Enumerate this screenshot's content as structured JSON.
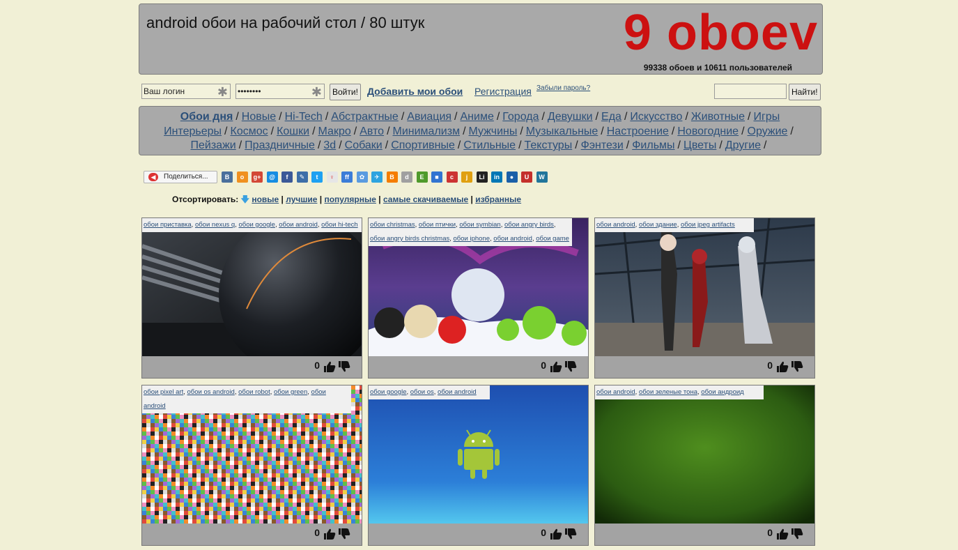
{
  "header": {
    "title": "android обои на рабочий стол / 80 штук",
    "logo": "9 oboev",
    "stats": "99338 обоев и 10611 пользователей"
  },
  "login": {
    "username_value": "Ваш логин",
    "password_value": "••••••••",
    "submit": "Войти!",
    "add_link": "Добавить мои обои",
    "register": "Регистрация",
    "forgot": "Забыли пароль?",
    "search_value": "",
    "search_button": "Найти!"
  },
  "categories": [
    "Обои дня",
    "Новые",
    "Hi-Tech",
    "Абстрактные",
    "Авиация",
    "Аниме",
    "Города",
    "Девушки",
    "Еда",
    "Искусство",
    "Животные",
    "Игры",
    "Интерьеры",
    "Космос",
    "Кошки",
    "Макро",
    "Авто",
    "Минимализм",
    "Мужчины",
    "Музыкальные",
    "Настроение",
    "Новогодние",
    "Оружие",
    "Пейзажи",
    "Праздничные",
    "3d",
    "Собаки",
    "Спортивные",
    "Стильные",
    "Текстуры",
    "Фэнтези",
    "Фильмы",
    "Цветы",
    "Другие"
  ],
  "share": {
    "label": "Поделиться...",
    "icons": [
      {
        "name": "vkontakte-icon",
        "glyph": "В",
        "color": "#4a6f9c"
      },
      {
        "name": "odnoklassniki-icon",
        "glyph": "о",
        "color": "#f09020"
      },
      {
        "name": "google-plus-icon",
        "glyph": "g+",
        "color": "#d34836"
      },
      {
        "name": "mail-ru-icon",
        "glyph": "@",
        "color": "#168de2"
      },
      {
        "name": "facebook-icon",
        "glyph": "f",
        "color": "#3b5998"
      },
      {
        "name": "livejournal-icon",
        "glyph": "✎",
        "color": "#3d6ea8"
      },
      {
        "name": "twitter-icon",
        "glyph": "t",
        "color": "#1da1f2"
      },
      {
        "name": "liveinternet-icon",
        "glyph": "♀",
        "color": "#e6e6e6"
      },
      {
        "name": "friendfeed-icon",
        "glyph": "ff",
        "color": "#3b7dd8"
      },
      {
        "name": "myspace-icon",
        "glyph": "✿",
        "color": "#5a9be0"
      },
      {
        "name": "bookmarks-icon",
        "glyph": "✈",
        "color": "#2ea4e0"
      },
      {
        "name": "blogger-icon",
        "glyph": "B",
        "color": "#f57d00"
      },
      {
        "name": "digg-icon",
        "glyph": "d",
        "color": "#a0a0a0"
      },
      {
        "name": "evernote-icon",
        "glyph": "E",
        "color": "#4f9a2b"
      },
      {
        "name": "delicious-icon",
        "glyph": "■",
        "color": "#3274d1"
      },
      {
        "name": "stumbleupon-icon",
        "glyph": "c",
        "color": "#c33"
      },
      {
        "name": "juick-icon",
        "glyph": "j",
        "color": "#e0a010"
      },
      {
        "name": "liveinternet-li-icon",
        "glyph": "Li",
        "color": "#222"
      },
      {
        "name": "linkedin-icon",
        "glyph": "in",
        "color": "#0077b5"
      },
      {
        "name": "moimir-icon",
        "glyph": "●",
        "color": "#1a5fa8"
      },
      {
        "name": "surfingbird-icon",
        "glyph": "U",
        "color": "#c4302b"
      },
      {
        "name": "wordpress-icon",
        "glyph": "W",
        "color": "#21759b"
      }
    ]
  },
  "sort": {
    "label": "Отсортировать:",
    "options": [
      "новые",
      "лучшие",
      "популярные",
      "самые скачиваемые",
      "избранные"
    ]
  },
  "wallpapers": [
    {
      "tags": [
        "обои приставка",
        "обои nexus q",
        "обои google",
        "обои android",
        "обои hi-tech"
      ],
      "votes": "0",
      "theme": "nexus"
    },
    {
      "tags": [
        "обои christmas",
        "обои птички",
        "обои symbian",
        "обои angry birds",
        "обои angry birds christmas",
        "обои iphone",
        "обои android",
        "обои game"
      ],
      "votes": "0",
      "theme": "birds"
    },
    {
      "tags": [
        "обои android",
        "обои здание",
        "обои jpeg artifacts"
      ],
      "votes": "0",
      "theme": "anime"
    },
    {
      "tags": [
        "обои pixel art",
        "обои os android",
        "обои robot",
        "обои green",
        "обои android"
      ],
      "votes": "0",
      "theme": "pixel"
    },
    {
      "tags": [
        "обои google",
        "обои os",
        "обои android"
      ],
      "votes": "0",
      "theme": "robot"
    },
    {
      "tags": [
        "обои android",
        "обои зеленые тона",
        "обои андроид"
      ],
      "votes": "0",
      "theme": "green"
    }
  ]
}
